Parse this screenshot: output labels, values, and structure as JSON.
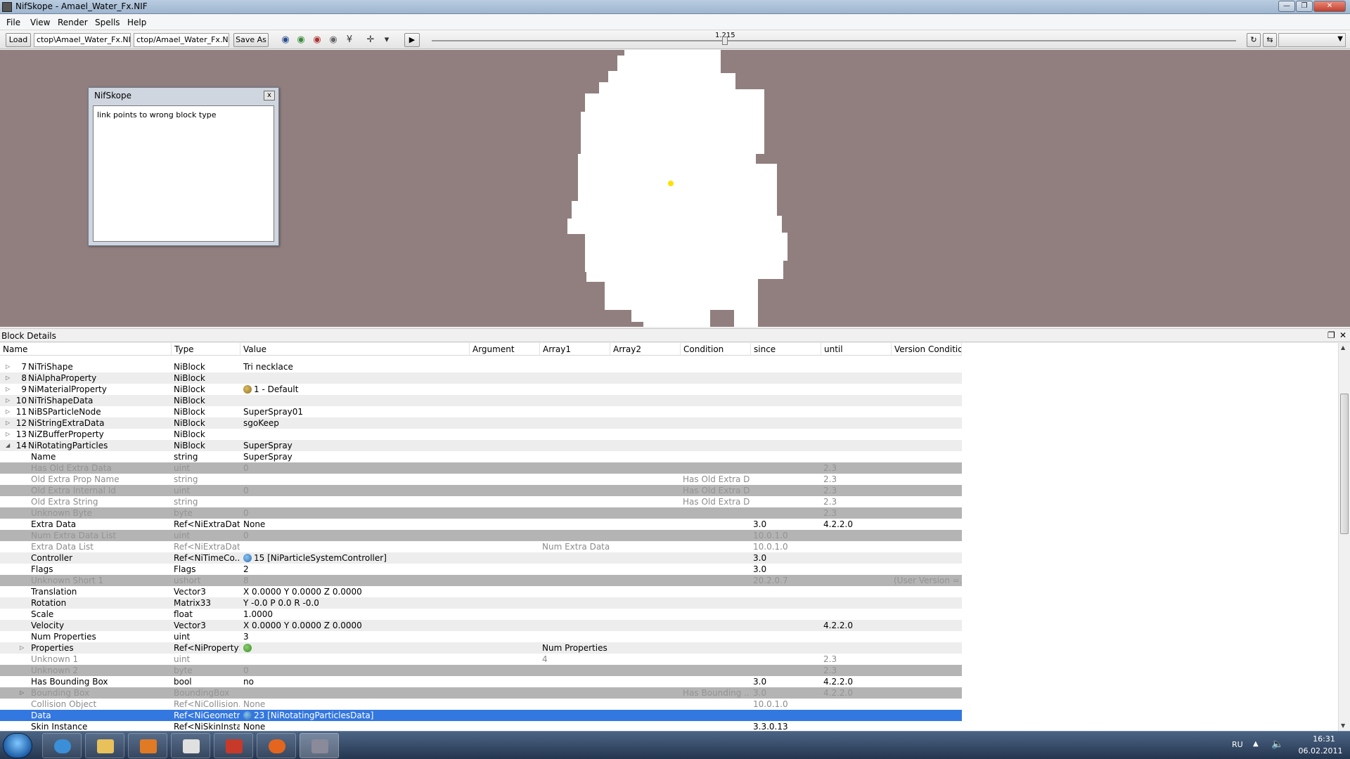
{
  "window": {
    "title": "NifSkope - Amael_Water_Fx.NIF"
  },
  "menu": [
    "File",
    "View",
    "Render",
    "Spells",
    "Help"
  ],
  "toolbar": {
    "load_label": "Load",
    "load_path": "ctop\\Amael_Water_Fx.NIF",
    "save_path": "ctop/Amael_Water_Fx.NIF",
    "save_as_label": "Save As",
    "time_value": "1.215"
  },
  "message_dialog": {
    "title": "NifSkope",
    "close": "x",
    "text": "link points to wrong block type"
  },
  "block_details": {
    "title": "Block Details",
    "columns": [
      "Name",
      "Type",
      "Value",
      "Argument",
      "Array1",
      "Array2",
      "Condition",
      "since",
      "until",
      "Version Condition"
    ],
    "rows": [
      {
        "indent": 0,
        "expand": "collapsed",
        "num": "7",
        "name": "NiTriShape",
        "type": "NiBlock",
        "value": "Tri necklace",
        "argument": "",
        "array1": "",
        "condition": "",
        "since": "",
        "until": "",
        "vcond": "",
        "state": "normal",
        "icon": ""
      },
      {
        "indent": 0,
        "expand": "collapsed",
        "num": "8",
        "name": "NiAlphaProperty",
        "type": "NiBlock",
        "value": "",
        "argument": "",
        "array1": "",
        "condition": "",
        "since": "",
        "until": "",
        "vcond": "",
        "state": "normal",
        "icon": ""
      },
      {
        "indent": 0,
        "expand": "collapsed",
        "num": "9",
        "name": "NiMaterialProperty",
        "type": "NiBlock",
        "value": "1 - Default",
        "argument": "",
        "array1": "",
        "condition": "",
        "since": "",
        "until": "",
        "vcond": "",
        "state": "normal",
        "icon": "material-icon"
      },
      {
        "indent": 0,
        "expand": "collapsed",
        "num": "10",
        "name": "NiTriShapeData",
        "type": "NiBlock",
        "value": "",
        "argument": "",
        "array1": "",
        "condition": "",
        "since": "",
        "until": "",
        "vcond": "",
        "state": "normal",
        "icon": ""
      },
      {
        "indent": 0,
        "expand": "collapsed",
        "num": "11",
        "name": "NiBSParticleNode",
        "type": "NiBlock",
        "value": "SuperSpray01",
        "argument": "",
        "array1": "",
        "condition": "",
        "since": "",
        "until": "",
        "vcond": "",
        "state": "normal",
        "icon": ""
      },
      {
        "indent": 0,
        "expand": "collapsed",
        "num": "12",
        "name": "NiStringExtraData",
        "type": "NiBlock",
        "value": "sgoKeep",
        "argument": "",
        "array1": "",
        "condition": "",
        "since": "",
        "until": "",
        "vcond": "",
        "state": "normal",
        "icon": ""
      },
      {
        "indent": 0,
        "expand": "collapsed",
        "num": "13",
        "name": "NiZBufferProperty",
        "type": "NiBlock",
        "value": "",
        "argument": "",
        "array1": "",
        "condition": "",
        "since": "",
        "until": "",
        "vcond": "",
        "state": "normal",
        "icon": ""
      },
      {
        "indent": 0,
        "expand": "expanded",
        "num": "14",
        "name": "NiRotatingParticles",
        "type": "NiBlock",
        "value": "SuperSpray",
        "argument": "",
        "array1": "",
        "condition": "",
        "since": "",
        "until": "",
        "vcond": "",
        "state": "normal",
        "icon": ""
      },
      {
        "indent": 1,
        "expand": "",
        "num": "",
        "name": "Name",
        "type": "string",
        "value": "SuperSpray",
        "argument": "",
        "array1": "",
        "condition": "",
        "since": "",
        "until": "",
        "vcond": "",
        "state": "normal",
        "icon": ""
      },
      {
        "indent": 1,
        "expand": "",
        "num": "",
        "name": "Has Old Extra Data",
        "type": "uint",
        "value": "0",
        "argument": "",
        "array1": "",
        "condition": "",
        "since": "",
        "until": "2.3",
        "vcond": "",
        "state": "disabled",
        "icon": ""
      },
      {
        "indent": 1,
        "expand": "",
        "num": "",
        "name": "Old Extra Prop Name",
        "type": "string",
        "value": "",
        "argument": "",
        "array1": "",
        "condition": "Has Old Extra D...",
        "since": "",
        "until": "2.3",
        "vcond": "",
        "state": "disabled",
        "icon": ""
      },
      {
        "indent": 1,
        "expand": "",
        "num": "",
        "name": "Old Extra Internal Id",
        "type": "uint",
        "value": "0",
        "argument": "",
        "array1": "",
        "condition": "Has Old Extra D...",
        "since": "",
        "until": "2.3",
        "vcond": "",
        "state": "disabled",
        "icon": ""
      },
      {
        "indent": 1,
        "expand": "",
        "num": "",
        "name": "Old Extra String",
        "type": "string",
        "value": "",
        "argument": "",
        "array1": "",
        "condition": "Has Old Extra D...",
        "since": "",
        "until": "2.3",
        "vcond": "",
        "state": "disabled",
        "icon": ""
      },
      {
        "indent": 1,
        "expand": "",
        "num": "",
        "name": "Unknown Byte",
        "type": "byte",
        "value": "0",
        "argument": "",
        "array1": "",
        "condition": "",
        "since": "",
        "until": "2.3",
        "vcond": "",
        "state": "disabled",
        "icon": ""
      },
      {
        "indent": 1,
        "expand": "",
        "num": "",
        "name": "Extra Data",
        "type": "Ref<NiExtraData>",
        "value": "None",
        "argument": "",
        "array1": "",
        "condition": "",
        "since": "3.0",
        "until": "4.2.2.0",
        "vcond": "",
        "state": "normal",
        "icon": ""
      },
      {
        "indent": 1,
        "expand": "",
        "num": "",
        "name": "Num Extra Data List",
        "type": "uint",
        "value": "0",
        "argument": "",
        "array1": "",
        "condition": "",
        "since": "10.0.1.0",
        "until": "",
        "vcond": "",
        "state": "disabled",
        "icon": ""
      },
      {
        "indent": 1,
        "expand": "",
        "num": "",
        "name": "Extra Data List",
        "type": "Ref<NiExtraData>",
        "value": "",
        "argument": "",
        "array1": "Num Extra Data...",
        "condition": "",
        "since": "10.0.1.0",
        "until": "",
        "vcond": "",
        "state": "disabled",
        "icon": ""
      },
      {
        "indent": 1,
        "expand": "",
        "num": "",
        "name": "Controller",
        "type": "Ref<NiTimeCo...",
        "value": "15 [NiParticleSystemController]",
        "argument": "",
        "array1": "",
        "condition": "",
        "since": "3.0",
        "until": "",
        "vcond": "",
        "state": "normal",
        "icon": "link-icon"
      },
      {
        "indent": 1,
        "expand": "",
        "num": "",
        "name": "Flags",
        "type": "Flags",
        "value": "2",
        "argument": "",
        "array1": "",
        "condition": "",
        "since": "3.0",
        "until": "",
        "vcond": "",
        "state": "normal",
        "icon": ""
      },
      {
        "indent": 1,
        "expand": "",
        "num": "",
        "name": "Unknown Short 1",
        "type": "ushort",
        "value": "8",
        "argument": "",
        "array1": "",
        "condition": "",
        "since": "20.2.0.7",
        "until": "",
        "vcond": "(User Version =...",
        "state": "disabled",
        "icon": ""
      },
      {
        "indent": 1,
        "expand": "",
        "num": "",
        "name": "Translation",
        "type": "Vector3",
        "value": "X 0.0000 Y 0.0000 Z 0.0000",
        "argument": "",
        "array1": "",
        "condition": "",
        "since": "",
        "until": "",
        "vcond": "",
        "state": "normal",
        "icon": ""
      },
      {
        "indent": 1,
        "expand": "",
        "num": "",
        "name": "Rotation",
        "type": "Matrix33",
        "value": "Y -0.0 P 0.0 R -0.0",
        "argument": "",
        "array1": "",
        "condition": "",
        "since": "",
        "until": "",
        "vcond": "",
        "state": "normal",
        "icon": ""
      },
      {
        "indent": 1,
        "expand": "",
        "num": "",
        "name": "Scale",
        "type": "float",
        "value": "1.0000",
        "argument": "",
        "array1": "",
        "condition": "",
        "since": "",
        "until": "",
        "vcond": "",
        "state": "normal",
        "icon": ""
      },
      {
        "indent": 1,
        "expand": "",
        "num": "",
        "name": "Velocity",
        "type": "Vector3",
        "value": "X 0.0000 Y 0.0000 Z 0.0000",
        "argument": "",
        "array1": "",
        "condition": "",
        "since": "",
        "until": "4.2.2.0",
        "vcond": "",
        "state": "normal",
        "icon": ""
      },
      {
        "indent": 1,
        "expand": "",
        "num": "",
        "name": "Num Properties",
        "type": "uint",
        "value": "3",
        "argument": "",
        "array1": "",
        "condition": "",
        "since": "",
        "until": "",
        "vcond": "",
        "state": "normal",
        "icon": ""
      },
      {
        "indent": 1,
        "expand": "collapsed",
        "num": "",
        "name": "Properties",
        "type": "Ref<NiProperty>",
        "value": "",
        "argument": "",
        "array1": "Num Properties",
        "condition": "",
        "since": "",
        "until": "",
        "vcond": "",
        "state": "normal",
        "icon": "property-icon"
      },
      {
        "indent": 1,
        "expand": "",
        "num": "",
        "name": "Unknown 1",
        "type": "uint",
        "value": "",
        "argument": "",
        "array1": "4",
        "condition": "",
        "since": "",
        "until": "2.3",
        "vcond": "",
        "state": "disabled",
        "icon": ""
      },
      {
        "indent": 1,
        "expand": "",
        "num": "",
        "name": "Unknown 2",
        "type": "byte",
        "value": "0",
        "argument": "",
        "array1": "",
        "condition": "",
        "since": "",
        "until": "2.3",
        "vcond": "",
        "state": "disabled",
        "icon": ""
      },
      {
        "indent": 1,
        "expand": "",
        "num": "",
        "name": "Has Bounding Box",
        "type": "bool",
        "value": "no",
        "argument": "",
        "array1": "",
        "condition": "",
        "since": "3.0",
        "until": "4.2.2.0",
        "vcond": "",
        "state": "normal",
        "icon": ""
      },
      {
        "indent": 1,
        "expand": "collapsed",
        "num": "",
        "name": "Bounding Box",
        "type": "BoundingBox",
        "value": "",
        "argument": "",
        "array1": "",
        "condition": "Has Bounding ...",
        "since": "3.0",
        "until": "4.2.2.0",
        "vcond": "",
        "state": "disabled",
        "icon": ""
      },
      {
        "indent": 1,
        "expand": "",
        "num": "",
        "name": "Collision Object",
        "type": "Ref<NiCollision...",
        "value": "None",
        "argument": "",
        "array1": "",
        "condition": "",
        "since": "10.0.1.0",
        "until": "",
        "vcond": "",
        "state": "disabled",
        "icon": ""
      },
      {
        "indent": 1,
        "expand": "",
        "num": "",
        "name": "Data",
        "type": "Ref<NiGeometr...",
        "value": "23 [NiRotatingParticlesData]",
        "argument": "",
        "array1": "",
        "condition": "",
        "since": "",
        "until": "",
        "vcond": "",
        "state": "selected",
        "icon": "link-icon"
      },
      {
        "indent": 1,
        "expand": "",
        "num": "",
        "name": "Skin Instance",
        "type": "Ref<NiSkinInsta...",
        "value": "None",
        "argument": "",
        "array1": "",
        "condition": "",
        "since": "3.3.0.13",
        "until": "",
        "vcond": "",
        "state": "normal",
        "icon": ""
      }
    ]
  },
  "taskbar": {
    "apps": [
      "internet-explorer",
      "file-explorer",
      "media-player",
      "3d-app",
      "drawing-app",
      "firefox",
      "nifskope"
    ],
    "language": "RU",
    "time": "16:31",
    "date": "06.02.2011"
  },
  "colors": {
    "viewport_bg": "#917f7f",
    "selection": "#3377e0",
    "particle_dot": "#ffe000"
  }
}
